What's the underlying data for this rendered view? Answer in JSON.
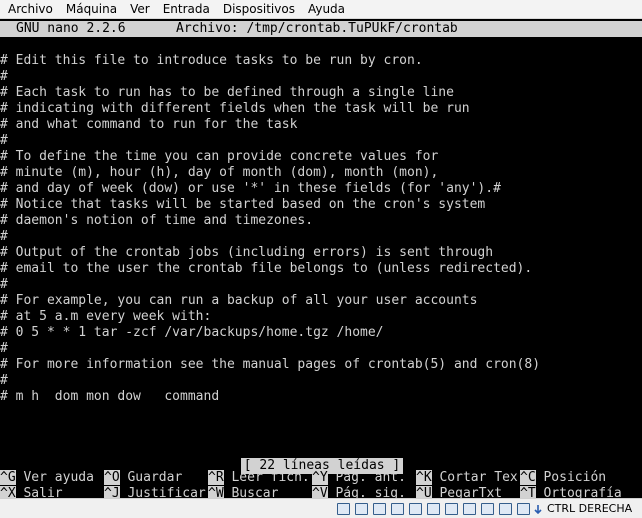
{
  "host_menu": {
    "items": [
      "Archivo",
      "Máquina",
      "Ver",
      "Entrada",
      "Dispositivos",
      "Ayuda"
    ]
  },
  "nano": {
    "version": "GNU nano 2.2.6",
    "file_title": "Archivo: /tmp/crontab.TuPUkF/crontab",
    "content_lines": [
      "# Edit this file to introduce tasks to be run by cron.",
      "#",
      "# Each task to run has to be defined through a single line",
      "# indicating with different fields when the task will be run",
      "# and what command to run for the task",
      "#",
      "# To define the time you can provide concrete values for",
      "# minute (m), hour (h), day of month (dom), month (mon),",
      "# and day of week (dow) or use '*' in these fields (for 'any').#",
      "# Notice that tasks will be started based on the cron's system",
      "# daemon's notion of time and timezones.",
      "#",
      "# Output of the crontab jobs (including errors) is sent through",
      "# email to the user the crontab file belongs to (unless redirected).",
      "#",
      "# For example, you can run a backup of all your user accounts",
      "# at 5 a.m every week with:",
      "# 0 5 * * 1 tar -zcf /var/backups/home.tgz /home/",
      "#",
      "# For more information see the manual pages of crontab(5) and cron(8)",
      "#",
      "# m h  dom mon dow   command"
    ],
    "status_message": "[ 22 líneas leídas ]",
    "shortcuts_row1": [
      {
        "key": "^G",
        "label": " Ver ayuda "
      },
      {
        "key": "^O",
        "label": " Guardar   "
      },
      {
        "key": "^R",
        "label": " Leer fich."
      },
      {
        "key": "^Y",
        "label": " Pág. ant. "
      },
      {
        "key": "^K",
        "label": " Cortar Tex"
      },
      {
        "key": "^C",
        "label": " Posición"
      }
    ],
    "shortcuts_row2": [
      {
        "key": "^X",
        "label": " Salir     "
      },
      {
        "key": "^J",
        "label": " Justificar"
      },
      {
        "key": "^W",
        "label": " Buscar    "
      },
      {
        "key": "^V",
        "label": " Pág. sig. "
      },
      {
        "key": "^U",
        "label": " PegarTxt  "
      },
      {
        "key": "^T",
        "label": " Ortografía"
      }
    ]
  },
  "vbox_status": {
    "icons": [
      "hard-disk-icon",
      "optical-drive-icon",
      "audio-icon",
      "network-icon",
      "usb-icon",
      "shared-folder-icon",
      "display-icon",
      "video-capture-icon",
      "recording-icon",
      "cpu-icon",
      "mouse-integration-icon"
    ],
    "host_key_label": "CTRL DERECHA"
  }
}
